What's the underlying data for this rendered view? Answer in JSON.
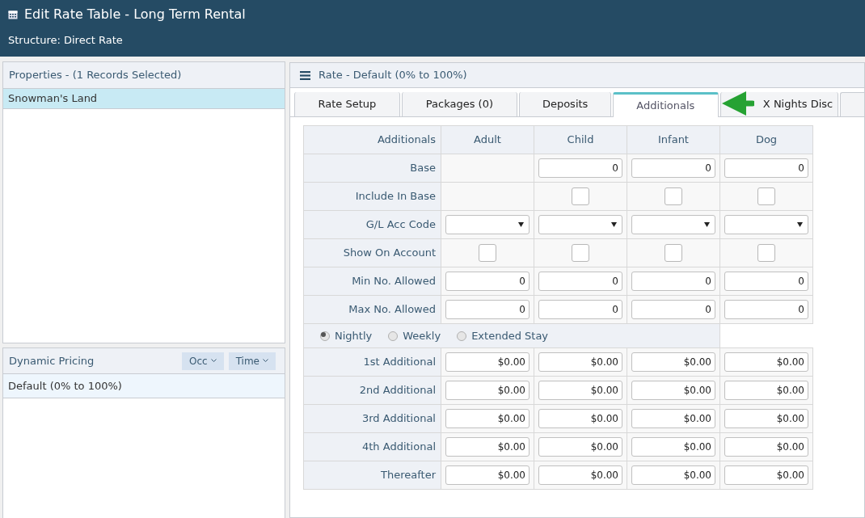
{
  "header": {
    "title": "Edit Rate Table - Long Term Rental",
    "subtitle": "Structure: Direct Rate"
  },
  "properties": {
    "title": "Properties - (1 Records Selected)",
    "items": [
      {
        "label": "Snowman's Land",
        "selected": true
      }
    ]
  },
  "dynamic_pricing": {
    "title": "Dynamic Pricing",
    "buttons": [
      "Occ",
      "Time"
    ],
    "items": [
      {
        "label": "Default (0% to 100%)",
        "selected": true
      }
    ]
  },
  "rate_panel": {
    "title": "Rate - Default (0% to 100%)",
    "tabs": [
      {
        "label": "Rate Setup",
        "selected": false
      },
      {
        "label": "Packages (0)",
        "selected": false
      },
      {
        "label": "Deposits",
        "selected": false
      },
      {
        "label": "Additionals",
        "selected": true
      },
      {
        "label": "X Nights Disc",
        "selected": false
      }
    ],
    "table": {
      "corner_label": "Additionals",
      "columns": [
        "Adult",
        "Child",
        "Infant",
        "Dog"
      ],
      "rows": [
        {
          "label": "Base",
          "cells": [
            {
              "kind": "empty"
            },
            {
              "kind": "number",
              "value": "0"
            },
            {
              "kind": "number",
              "value": "0"
            },
            {
              "kind": "number",
              "value": "0"
            }
          ]
        },
        {
          "label": "Include In Base",
          "cells": [
            {
              "kind": "empty"
            },
            {
              "kind": "checkbox",
              "checked": false
            },
            {
              "kind": "checkbox",
              "checked": false
            },
            {
              "kind": "checkbox",
              "checked": false
            }
          ]
        },
        {
          "label": "G/L Acc Code",
          "cells": [
            {
              "kind": "select"
            },
            {
              "kind": "select"
            },
            {
              "kind": "select"
            },
            {
              "kind": "select"
            }
          ]
        },
        {
          "label": "Show On Account",
          "cells": [
            {
              "kind": "checkbox",
              "checked": false
            },
            {
              "kind": "checkbox",
              "checked": false
            },
            {
              "kind": "checkbox",
              "checked": false
            },
            {
              "kind": "checkbox",
              "checked": false
            }
          ]
        },
        {
          "label": "Min No. Allowed",
          "cells": [
            {
              "kind": "number",
              "value": "0"
            },
            {
              "kind": "number",
              "value": "0"
            },
            {
              "kind": "number",
              "value": "0"
            },
            {
              "kind": "number",
              "value": "0"
            }
          ]
        },
        {
          "label": "Max No. Allowed",
          "cells": [
            {
              "kind": "number",
              "value": "0"
            },
            {
              "kind": "number",
              "value": "0"
            },
            {
              "kind": "number",
              "value": "0"
            },
            {
              "kind": "number",
              "value": "0"
            }
          ]
        }
      ],
      "rate_basis": [
        {
          "label": "Nightly",
          "selected": true
        },
        {
          "label": "Weekly",
          "selected": false
        },
        {
          "label": "Extended Stay",
          "selected": false
        }
      ],
      "additional_rows": [
        {
          "label": "1st Additional",
          "values": [
            "$0.00",
            "$0.00",
            "$0.00",
            "$0.00"
          ]
        },
        {
          "label": "2nd Additional",
          "values": [
            "$0.00",
            "$0.00",
            "$0.00",
            "$0.00"
          ]
        },
        {
          "label": "3rd Additional",
          "values": [
            "$0.00",
            "$0.00",
            "$0.00",
            "$0.00"
          ]
        },
        {
          "label": "4th Additional",
          "values": [
            "$0.00",
            "$0.00",
            "$0.00",
            "$0.00"
          ]
        },
        {
          "label": "Thereafter",
          "values": [
            "$0.00",
            "$0.00",
            "$0.00",
            "$0.00"
          ]
        }
      ]
    }
  }
}
